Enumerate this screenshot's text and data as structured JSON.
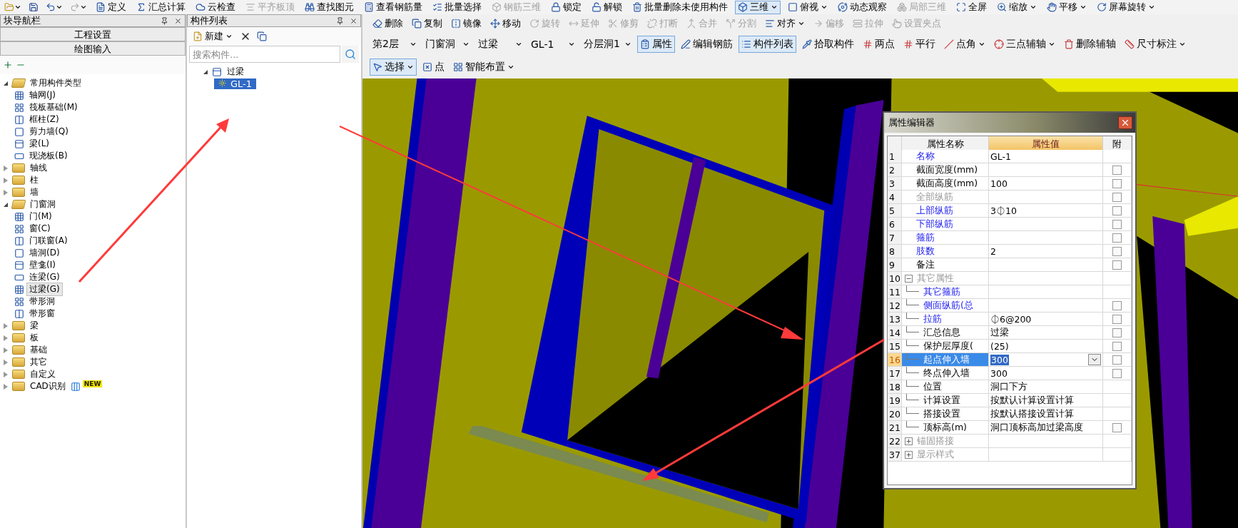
{
  "main_toolbar": [
    {
      "label": "定义",
      "disabled": false,
      "dropdown": false,
      "active": false
    },
    {
      "label": "汇总计算",
      "disabled": false,
      "dropdown": false,
      "active": false
    },
    {
      "label": "云检查",
      "disabled": false,
      "dropdown": false,
      "active": false
    },
    {
      "label": "平齐板顶",
      "disabled": true,
      "dropdown": false,
      "active": false
    },
    {
      "label": "查找图元",
      "disabled": false,
      "dropdown": false,
      "active": false
    },
    {
      "label": "查看钢筋量",
      "disabled": false,
      "dropdown": false,
      "active": false
    },
    {
      "label": "批量选择",
      "disabled": false,
      "dropdown": false,
      "active": false
    },
    {
      "label": "钢筋三维",
      "disabled": true,
      "dropdown": false,
      "active": false
    },
    {
      "label": "锁定",
      "disabled": false,
      "dropdown": false,
      "active": false
    },
    {
      "label": "解锁",
      "disabled": false,
      "dropdown": false,
      "active": false
    },
    {
      "label": "批量删除未使用构件",
      "disabled": false,
      "dropdown": false,
      "active": false
    },
    {
      "label": "三维",
      "disabled": false,
      "dropdown": true,
      "active": true
    },
    {
      "label": "俯视",
      "disabled": false,
      "dropdown": true,
      "active": false
    },
    {
      "label": "动态观察",
      "disabled": false,
      "dropdown": false,
      "active": false
    },
    {
      "label": "局部三维",
      "disabled": true,
      "dropdown": false,
      "active": false
    },
    {
      "label": "全屏",
      "disabled": false,
      "dropdown": false,
      "active": false
    },
    {
      "label": "缩放",
      "disabled": false,
      "dropdown": true,
      "active": false
    },
    {
      "label": "平移",
      "disabled": false,
      "dropdown": true,
      "active": false
    },
    {
      "label": "屏幕旋转",
      "disabled": false,
      "dropdown": true,
      "active": false
    }
  ],
  "navigator": {
    "title": "块导航栏",
    "buttons": [
      "工程设置",
      "绘图输入"
    ],
    "tree": [
      {
        "label": "常用构件类型",
        "expanded": true,
        "children": [
          {
            "label": "轴网(J)",
            "selected": false
          },
          {
            "label": "筏板基础(M)",
            "selected": false
          },
          {
            "label": "框柱(Z)",
            "selected": false
          },
          {
            "label": "剪力墙(Q)",
            "selected": false
          },
          {
            "label": "梁(L)",
            "selected": false
          },
          {
            "label": "现浇板(B)",
            "selected": false
          }
        ]
      },
      {
        "label": "轴线",
        "expanded": false
      },
      {
        "label": "柱",
        "expanded": false
      },
      {
        "label": "墙",
        "expanded": false
      },
      {
        "label": "门窗洞",
        "expanded": true,
        "children": [
          {
            "label": "门(M)",
            "selected": false
          },
          {
            "label": "窗(C)",
            "selected": false
          },
          {
            "label": "门联窗(A)",
            "selected": false
          },
          {
            "label": "墙洞(D)",
            "selected": false
          },
          {
            "label": "壁龛(I)",
            "selected": false
          },
          {
            "label": "连梁(G)",
            "selected": false
          },
          {
            "label": "过梁(G)",
            "selected": true
          },
          {
            "label": "带形洞",
            "selected": false
          },
          {
            "label": "带形窗",
            "selected": false
          }
        ]
      },
      {
        "label": "梁",
        "expanded": false
      },
      {
        "label": "板",
        "expanded": false
      },
      {
        "label": "基础",
        "expanded": false
      },
      {
        "label": "其它",
        "expanded": false
      },
      {
        "label": "自定义",
        "expanded": false
      },
      {
        "label": "CAD识别",
        "expanded": false,
        "badge": "NEW"
      }
    ]
  },
  "component_list": {
    "title": "构件列表",
    "new_button": "新建",
    "search": {
      "placeholder": "搜索构件..."
    },
    "tree": [
      {
        "label": "过梁",
        "expanded": true,
        "children": [
          {
            "label": "GL-1",
            "selected": true
          }
        ]
      }
    ]
  },
  "edit_toolbar": [
    {
      "label": "删除",
      "disabled": false,
      "dropdown": false
    },
    {
      "label": "复制",
      "disabled": false,
      "dropdown": false
    },
    {
      "label": "镜像",
      "disabled": false,
      "dropdown": false
    },
    {
      "label": "移动",
      "disabled": false,
      "dropdown": false
    },
    {
      "label": "旋转",
      "disabled": true,
      "dropdown": false
    },
    {
      "label": "延伸",
      "disabled": true,
      "dropdown": false
    },
    {
      "label": "修剪",
      "disabled": true,
      "dropdown": false
    },
    {
      "label": "打断",
      "disabled": true,
      "dropdown": false
    },
    {
      "label": "合并",
      "disabled": true,
      "dropdown": false
    },
    {
      "label": "分割",
      "disabled": true,
      "dropdown": false
    },
    {
      "label": "对齐",
      "disabled": false,
      "dropdown": true
    },
    {
      "label": "偏移",
      "disabled": true,
      "dropdown": false
    },
    {
      "label": "拉伸",
      "disabled": true,
      "dropdown": false
    },
    {
      "label": "设置夹点",
      "disabled": true,
      "dropdown": false
    }
  ],
  "selectors": [
    "第2层",
    "门窗洞",
    "过梁",
    "GL-1",
    "分层洞1"
  ],
  "view_toolbar": [
    {
      "label": "属性",
      "active": true,
      "dropdown": false
    },
    {
      "label": "编辑钢筋",
      "active": false,
      "dropdown": false
    },
    {
      "label": "构件列表",
      "active": true,
      "dropdown": false
    },
    {
      "label": "拾取构件",
      "active": false,
      "dropdown": false
    },
    {
      "label": "两点",
      "active": false,
      "dropdown": false
    },
    {
      "label": "平行",
      "active": false,
      "dropdown": false
    },
    {
      "label": "点角",
      "active": false,
      "dropdown": true
    },
    {
      "label": "三点辅轴",
      "active": false,
      "dropdown": true
    },
    {
      "label": "删除辅轴",
      "active": false,
      "dropdown": false
    },
    {
      "label": "尺寸标注",
      "active": false,
      "dropdown": true
    }
  ],
  "draw_toolbar": [
    {
      "label": "选择",
      "active": true,
      "dropdown": true
    },
    {
      "label": "点",
      "active": false,
      "dropdown": false
    },
    {
      "label": "智能布置",
      "active": false,
      "dropdown": true
    }
  ],
  "property_editor": {
    "title": "属性编辑器",
    "columns": [
      "属性名称",
      "属性值",
      "附"
    ],
    "rows": [
      {
        "index": "1",
        "name": "名称",
        "value": "GL-1",
        "kind": "link",
        "has_attach": false,
        "selected": false
      },
      {
        "index": "2",
        "name": "截面宽度(mm)",
        "kind": "plain",
        "has_attach": true,
        "checked": false,
        "selected": false
      },
      {
        "index": "3",
        "name": "截面高度(mm)",
        "value": "100",
        "kind": "plain",
        "has_attach": true,
        "checked": false,
        "selected": false
      },
      {
        "index": "4",
        "name": "全部纵筋",
        "kind": "muted",
        "has_attach": true,
        "checked": false,
        "selected": false
      },
      {
        "index": "5",
        "name": "上部纵筋",
        "value": "3⏀10",
        "kind": "link",
        "has_attach": true,
        "checked": false,
        "selected": false
      },
      {
        "index": "6",
        "name": "下部纵筋",
        "kind": "link",
        "has_attach": true,
        "checked": false,
        "selected": false
      },
      {
        "index": "7",
        "name": "箍筋",
        "kind": "link",
        "has_attach": true,
        "checked": false,
        "selected": false
      },
      {
        "index": "8",
        "name": "肢数",
        "value": "2",
        "kind": "link",
        "has_attach": true,
        "checked": false,
        "selected": false
      },
      {
        "index": "9",
        "name": "备注",
        "kind": "plain",
        "has_attach": true,
        "checked": false,
        "selected": false
      },
      {
        "index": "10",
        "name": "其它属性",
        "kind": "muted",
        "has_attach": false,
        "selected": false,
        "expanded": true,
        "children": [
          {
            "index": "11",
            "name": "其它箍筋",
            "kind": "link",
            "has_attach": false,
            "selected": false
          },
          {
            "index": "12",
            "name": "侧面纵筋(总",
            "kind": "link",
            "has_attach": true,
            "checked": false,
            "selected": false
          },
          {
            "index": "13",
            "name": "拉筋",
            "value": "⏀6@200",
            "kind": "link",
            "has_attach": true,
            "checked": false,
            "selected": false
          },
          {
            "index": "14",
            "name": "汇总信息",
            "value": "过梁",
            "kind": "plain",
            "has_attach": true,
            "checked": false,
            "selected": false
          },
          {
            "index": "15",
            "name": "保护层厚度(",
            "value": "(25)",
            "kind": "plain",
            "has_attach": true,
            "checked": false,
            "selected": false
          },
          {
            "index": "16",
            "name": "起点伸入墙",
            "value": "300",
            "kind": "plain",
            "has_attach": true,
            "checked": false,
            "selected": true
          },
          {
            "index": "17",
            "name": "终点伸入墙",
            "value": "300",
            "kind": "plain",
            "has_attach": true,
            "checked": false,
            "selected": false
          },
          {
            "index": "18",
            "name": "位置",
            "value": "洞口下方",
            "kind": "plain",
            "has_attach": false,
            "selected": false
          },
          {
            "index": "19",
            "name": "计算设置",
            "value": "按默认计算设置计算",
            "kind": "plain",
            "has_attach": false,
            "selected": false
          },
          {
            "index": "20",
            "name": "搭接设置",
            "value": "按默认搭接设置计算",
            "kind": "plain",
            "has_attach": false,
            "selected": false
          },
          {
            "index": "21",
            "name": "顶标高(m)",
            "value": "洞口顶标高加过梁高度",
            "kind": "plain",
            "has_attach": true,
            "checked": false,
            "selected": false
          }
        ]
      },
      {
        "index": "22",
        "name": "锚固搭接",
        "kind": "muted",
        "has_attach": false,
        "selected": false,
        "expanded": false
      },
      {
        "index": "37",
        "name": "显示样式",
        "kind": "muted",
        "has_attach": false,
        "selected": false,
        "expanded": false
      }
    ]
  }
}
